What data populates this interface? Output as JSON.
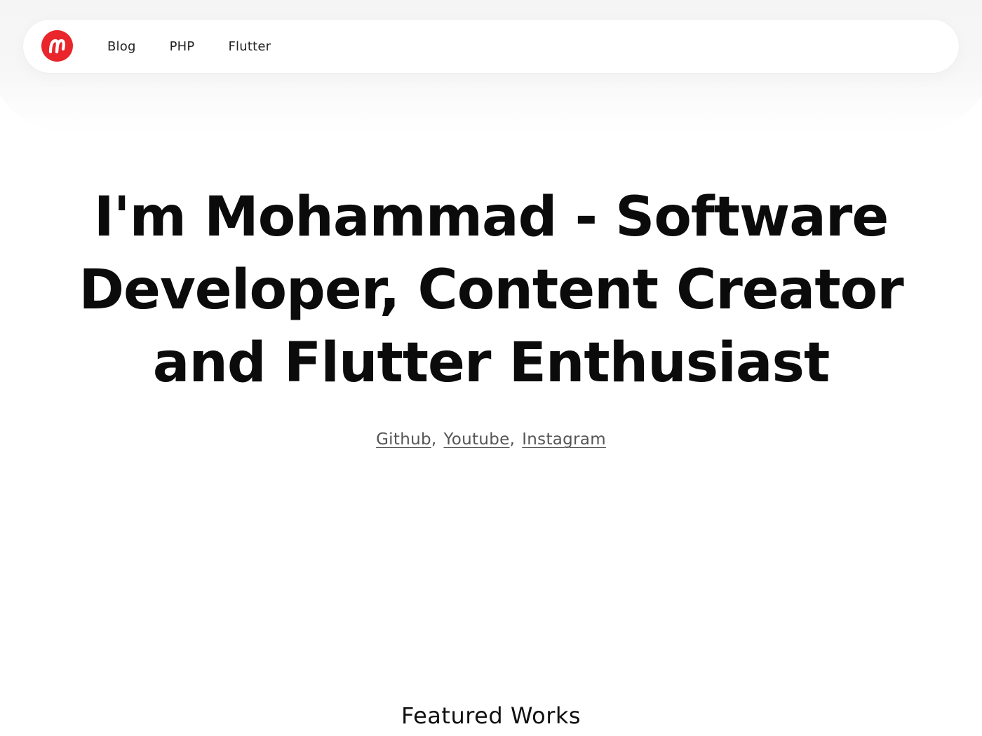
{
  "nav": {
    "logo_icon": "brand-logo-icon",
    "brand_color": "#e8262c",
    "links": [
      {
        "label": "Blog"
      },
      {
        "label": "PHP"
      },
      {
        "label": "Flutter"
      }
    ]
  },
  "hero": {
    "title_lines": [
      "I'm Mohammad - Software",
      "Developer, Content Creator",
      "and Flutter Enthusiast"
    ],
    "socials": [
      {
        "label": "Github"
      },
      {
        "label": "Youtube"
      },
      {
        "label": "Instagram"
      }
    ],
    "separator": ","
  },
  "featured": {
    "heading": "Featured Works"
  }
}
